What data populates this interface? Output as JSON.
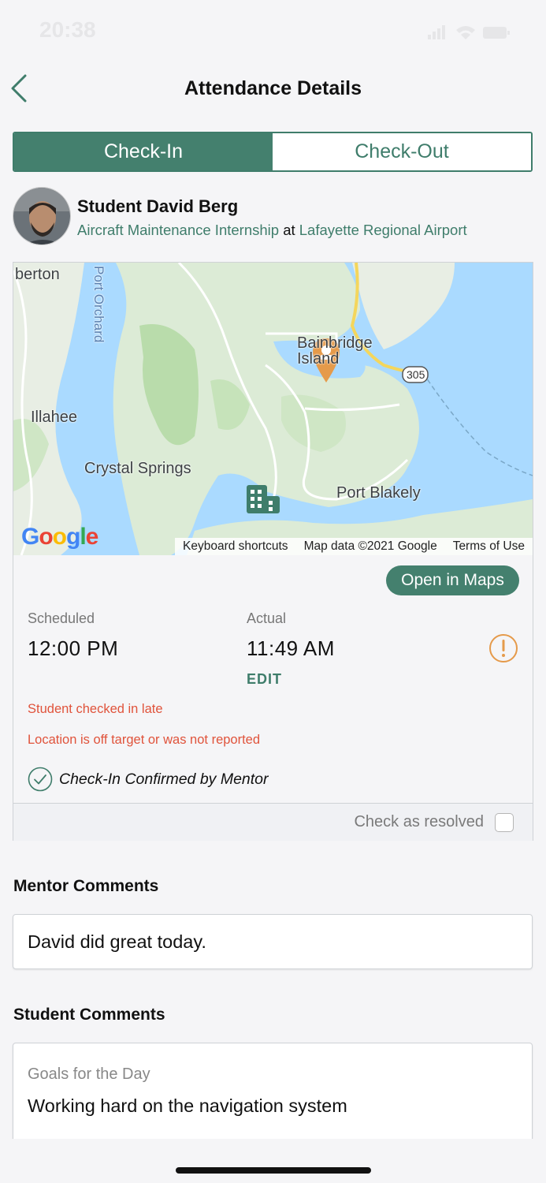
{
  "status_bar": {
    "time": "20:38"
  },
  "nav": {
    "title": "Attendance Details"
  },
  "segments": {
    "check_in": "Check-In",
    "check_out": "Check-Out",
    "selected": "Check-In"
  },
  "student": {
    "name": "Student David Berg",
    "program": "Aircraft Maintenance Internship",
    "connector": "at",
    "location": "Lafayette Regional Airport"
  },
  "map": {
    "labels": {
      "berton": "berton",
      "port_orchard": "Port Orchard",
      "illahee": "Illahee",
      "crystal_springs": "Crystal Springs",
      "port_blakely": "Port Blakely",
      "bainbridge": "Bainbridge Island",
      "route": "305"
    },
    "attribution": {
      "shortcuts": "Keyboard shortcuts",
      "data": "Map data ©2021 Google",
      "terms": "Terms of Use"
    },
    "logo": "Google"
  },
  "open_maps_label": "Open in Maps",
  "times": {
    "scheduled_label": "Scheduled",
    "scheduled_value": "12:00 PM",
    "actual_label": "Actual",
    "actual_value": "11:49 AM",
    "edit_label": "EDIT"
  },
  "alerts": {
    "late": "Student checked in late",
    "location": "Location is off target or was not reported"
  },
  "confirmation": "Check-In Confirmed by Mentor",
  "resolved_label": "Check as resolved",
  "mentor_comments": {
    "title": "Mentor Comments",
    "text": "David did great today."
  },
  "student_comments": {
    "title": "Student Comments",
    "subtitle": "Goals for the Day",
    "text": "Working hard on the navigation system"
  },
  "colors": {
    "accent": "#44806e",
    "error": "#e0533b",
    "warning": "#e59a4a"
  }
}
